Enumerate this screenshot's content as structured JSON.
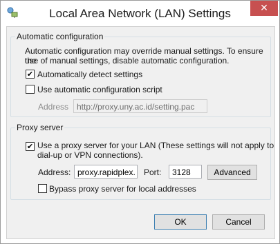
{
  "window": {
    "title": "Local Area Network (LAN) Settings",
    "close_glyph": "✕"
  },
  "auto_config": {
    "group_title": "Automatic configuration",
    "description_line1": "Automatic configuration may override manual settings.  To ensure the",
    "description_line2": "use of manual settings, disable automatic configuration.",
    "auto_detect_label": "Automatically detect settings",
    "auto_detect_checked": true,
    "use_script_label": "Use automatic configuration script",
    "use_script_checked": false,
    "address_label": "Address",
    "address_value": "http://proxy.uny.ac.id/setting.pac"
  },
  "proxy": {
    "group_title": "Proxy server",
    "use_proxy_line1": "Use a proxy server for your LAN (These settings will not apply to",
    "use_proxy_line2": "dial-up or VPN connections).",
    "use_proxy_checked": true,
    "address_label": "Address:",
    "address_value": "proxy.rapidplex.",
    "port_label": "Port:",
    "port_value": "3128",
    "advanced_label": "Advanced",
    "bypass_label": "Bypass proxy server for local addresses",
    "bypass_checked": false
  },
  "buttons": {
    "ok_label": "OK",
    "cancel_label": "Cancel"
  },
  "check_glyph": "✔",
  "colors": {
    "close_button": "#c75050",
    "group_border": "#d5dfe5",
    "dialog_bg": "#f0f0f0"
  }
}
